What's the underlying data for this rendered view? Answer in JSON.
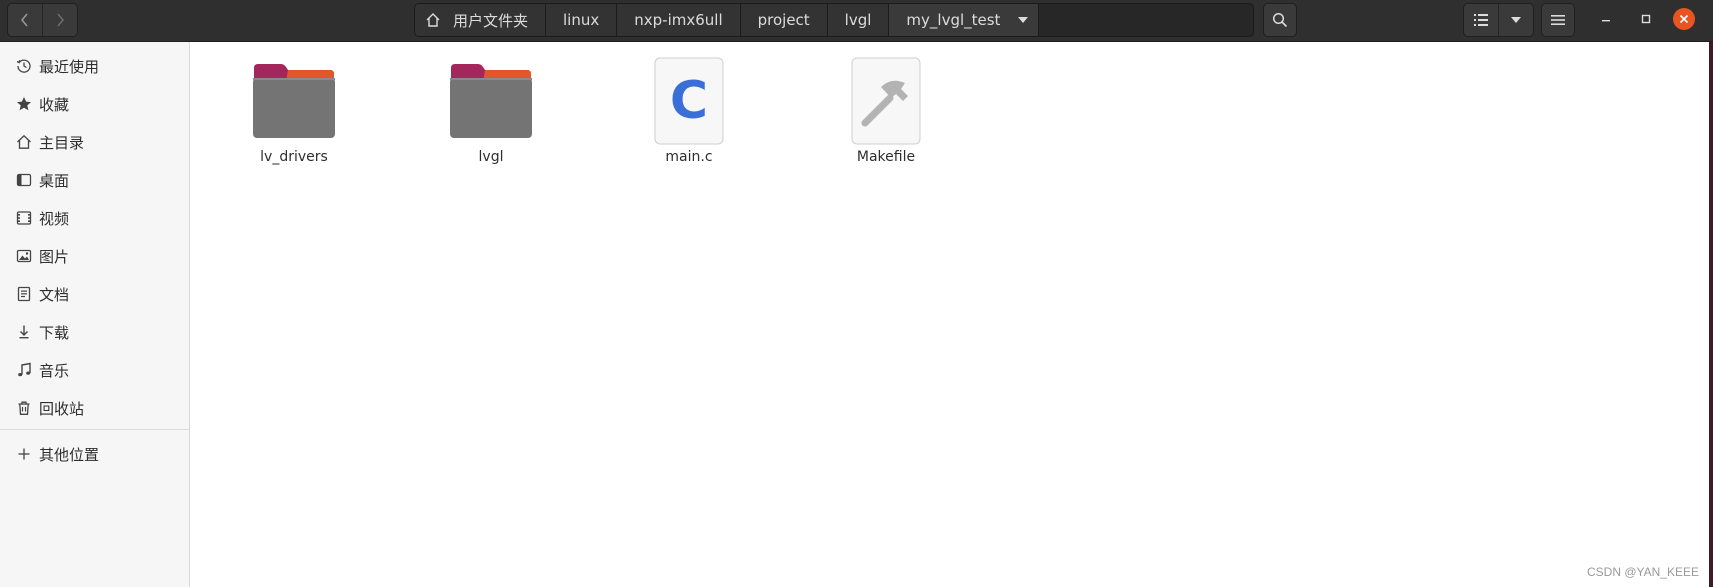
{
  "header": {
    "breadcrumbs": [
      "用户文件夹",
      "linux",
      "nxp-imx6ull",
      "project",
      "lvgl",
      "my_lvgl_test"
    ]
  },
  "sidebar": {
    "items": [
      {
        "label": "最近使用",
        "icon": "clock-icon"
      },
      {
        "label": "收藏",
        "icon": "star-icon"
      },
      {
        "label": "主目录",
        "icon": "home-icon"
      },
      {
        "label": "桌面",
        "icon": "desktop-icon"
      },
      {
        "label": "视频",
        "icon": "video-icon"
      },
      {
        "label": "图片",
        "icon": "picture-icon"
      },
      {
        "label": "文档",
        "icon": "document-icon"
      },
      {
        "label": "下载",
        "icon": "download-icon"
      },
      {
        "label": "音乐",
        "icon": "music-icon"
      },
      {
        "label": "回收站",
        "icon": "trash-icon"
      }
    ],
    "other_locations": {
      "label": "其他位置",
      "icon": "plus-icon"
    }
  },
  "files": [
    {
      "name": "lv_drivers",
      "type": "folder"
    },
    {
      "name": "lvgl",
      "type": "folder"
    },
    {
      "name": "main.c",
      "type": "c-source"
    },
    {
      "name": "Makefile",
      "type": "makefile"
    }
  ],
  "watermark": "CSDN @YAN_KEEE",
  "colors": {
    "accent": "#e95420",
    "folder_tab": "#a3265c",
    "c_letter": "#3b6fd8"
  }
}
